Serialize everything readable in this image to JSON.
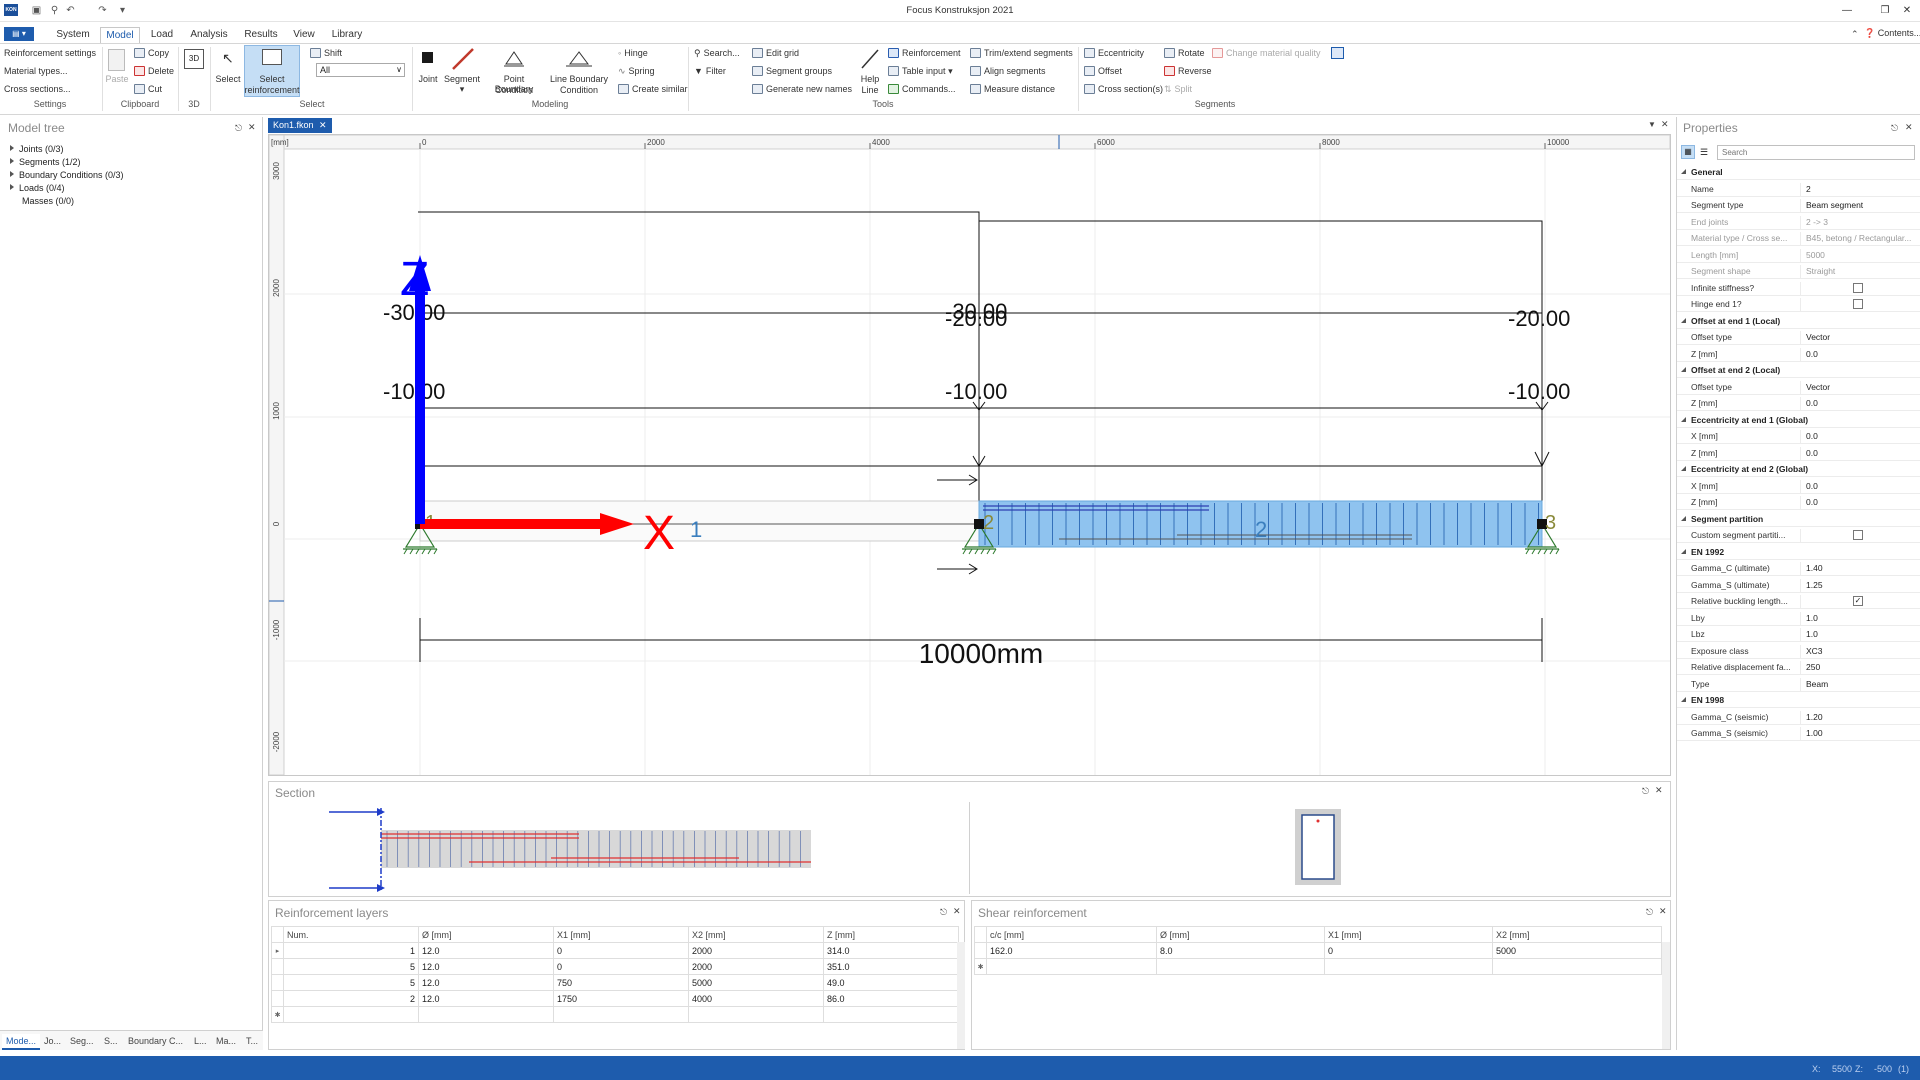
{
  "window": {
    "title": "Focus Konstruksjon 2021",
    "app_icon_text": "KON",
    "contents_label": "Contents..."
  },
  "ribbon_tabs": [
    "System",
    "Model",
    "Load",
    "Analysis",
    "Results",
    "View",
    "Library"
  ],
  "ribbon": {
    "settings": {
      "items": [
        "Reinforcement settings",
        "Material types...",
        "Cross sections..."
      ],
      "group": "Settings"
    },
    "clipboard": {
      "paste": "Paste",
      "copy": "Copy",
      "delete": "Delete",
      "cut": "Cut",
      "group": "Clipboard"
    },
    "three_d": {
      "icon_text": "3D",
      "group": "3D"
    },
    "select": {
      "select": "Select",
      "select_reinforcement_1": "Select",
      "select_reinforcement_2": "reinforcement",
      "shift": "Shift",
      "dropdown_value": "All",
      "group": "Select"
    },
    "modeling": {
      "joint": "Joint",
      "segment": "Segment",
      "point_bc_1": "Point Boundary",
      "point_bc_2": "Condition",
      "line_bc_1": "Line Boundary",
      "line_bc_2": "Condition",
      "hinge": "Hinge",
      "spring": "Spring",
      "create_similar": "Create similar",
      "group": "Modeling"
    },
    "tools": {
      "search": "Search...",
      "filter": "Filter",
      "edit_grid": "Edit grid",
      "segment_groups": "Segment groups",
      "generate_names": "Generate new names",
      "help_line_1": "Help",
      "help_line_2": "Line",
      "reinforcement": "Reinforcement",
      "table_input": "Table input",
      "commands": "Commands...",
      "trim_extend": "Trim/extend segments",
      "align_segments": "Align segments",
      "measure_distance": "Measure distance",
      "group": "Tools"
    },
    "segments": {
      "eccentricity": "Eccentricity",
      "offset": "Offset",
      "cross_sections": "Cross section(s)",
      "rotate": "Rotate",
      "reverse": "Reverse",
      "split": "Split",
      "change_material": "Change material quality",
      "group": "Segments"
    }
  },
  "model_tree": {
    "title": "Model tree",
    "items": [
      "Joints (0/3)",
      "Segments (1/2)",
      "Boundary Conditions (0/3)",
      "Loads (0/4)",
      "Masses (0/0)"
    ]
  },
  "left_bottom_tabs": [
    "Mode...",
    "Jo...",
    "Seg...",
    "S...",
    "Boundary C...",
    "L...",
    "Ma...",
    "T..."
  ],
  "document_tab": "Kon1.fkon",
  "canvas": {
    "unit_label": "[mm]",
    "x_ticks": [
      "0",
      "2000",
      "4000",
      "6000",
      "8000",
      "10000"
    ],
    "y_ticks": [
      "3000",
      "2000",
      "1000",
      "0",
      "-1000",
      "-2000"
    ],
    "load_labels": [
      "-30.00",
      "-30.00",
      "-20.00",
      "-20.00",
      "-10.00",
      "-10.00",
      "-10.00"
    ],
    "axis_z": "Z",
    "axis_x": "X",
    "axis_x_index": "1",
    "joint_labels": [
      "1",
      "2",
      "3"
    ],
    "segment_label": "2",
    "dimension": "10000mm",
    "colors": {
      "x_axis": "#ff0000",
      "z_axis": "#0000ff",
      "selected_segment": "#8fc3ef",
      "support": "#2d7a2d"
    }
  },
  "section_panel": {
    "title": "Section"
  },
  "reinforcement_layers": {
    "title": "Reinforcement layers",
    "columns": [
      "Num.",
      "Ø [mm]",
      "X1 [mm]",
      "X2 [mm]",
      "Z [mm]"
    ],
    "rows": [
      [
        "1",
        "12.0",
        "0",
        "2000",
        "314.0"
      ],
      [
        "5",
        "12.0",
        "0",
        "2000",
        "351.0"
      ],
      [
        "5",
        "12.0",
        "750",
        "5000",
        "49.0"
      ],
      [
        "2",
        "12.0",
        "1750",
        "4000",
        "86.0"
      ]
    ]
  },
  "shear_reinforcement": {
    "title": "Shear reinforcement",
    "columns": [
      "c/c [mm]",
      "Ø [mm]",
      "X1 [mm]",
      "X2 [mm]"
    ],
    "rows": [
      [
        "162.0",
        "8.0",
        "0",
        "5000"
      ]
    ]
  },
  "properties": {
    "title": "Properties",
    "search_placeholder": "Search",
    "rows": [
      {
        "cat": "General"
      },
      {
        "k": "Name",
        "v": "2"
      },
      {
        "k": "Segment type",
        "v": "Beam segment"
      },
      {
        "k": "End joints",
        "v": "2 -> 3",
        "ro": true
      },
      {
        "k": "Material type / Cross se...",
        "v": "B45, betong / Rectangular...",
        "ro": true
      },
      {
        "k": "Length [mm]",
        "v": "5000",
        "ro": true
      },
      {
        "k": "Segment shape",
        "v": "Straight",
        "ro": true
      },
      {
        "k": "Infinite stiffness?",
        "cb": false
      },
      {
        "k": "Hinge end 1?",
        "cb": false
      },
      {
        "cat": "Offset at end 1 (Local)"
      },
      {
        "k": "Offset type",
        "v": "Vector"
      },
      {
        "k": "Z [mm]",
        "v": "0.0"
      },
      {
        "cat": "Offset at end 2 (Local)"
      },
      {
        "k": "Offset type",
        "v": "Vector"
      },
      {
        "k": "Z [mm]",
        "v": "0.0"
      },
      {
        "cat": "Eccentricity at end 1 (Global)"
      },
      {
        "k": "X [mm]",
        "v": "0.0"
      },
      {
        "k": "Z [mm]",
        "v": "0.0"
      },
      {
        "cat": "Eccentricity at end 2 (Global)"
      },
      {
        "k": "X [mm]",
        "v": "0.0"
      },
      {
        "k": "Z [mm]",
        "v": "0.0"
      },
      {
        "cat": "Segment partition"
      },
      {
        "k": "Custom segment partiti...",
        "cb": false
      },
      {
        "cat": "EN 1992"
      },
      {
        "k": "Gamma_C (ultimate)",
        "v": "1.40"
      },
      {
        "k": "Gamma_S (ultimate)",
        "v": "1.25"
      },
      {
        "k": "Relative buckling length...",
        "cb": true
      },
      {
        "k": "Lby",
        "v": "1.0"
      },
      {
        "k": "Lbz",
        "v": "1.0"
      },
      {
        "k": "Exposure class",
        "v": "XC3"
      },
      {
        "k": "Relative displacement fa...",
        "v": "250"
      },
      {
        "k": "Type",
        "v": "Beam"
      },
      {
        "cat": "EN 1998"
      },
      {
        "k": "Gamma_C (seismic)",
        "v": "1.20"
      },
      {
        "k": "Gamma_S (seismic)",
        "v": "1.00"
      }
    ]
  },
  "status": {
    "x_label": "X:",
    "x_value": "5500",
    "z_label": "Z:",
    "z_value": "-500",
    "count": "(1)"
  }
}
